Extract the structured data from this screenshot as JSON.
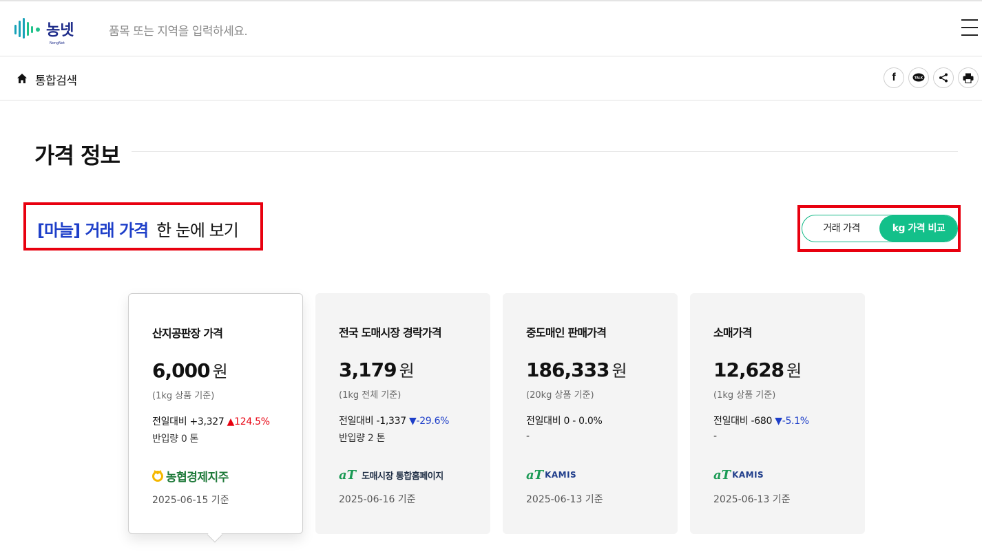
{
  "header": {
    "logo_text": "농넷",
    "logo_sub": "NongNet",
    "search_placeholder": "품목 또는 지역을 입력하세요."
  },
  "breadcrumb": {
    "label": "통합검색"
  },
  "share": {
    "icons": [
      "facebook-icon",
      "kakaotalk-icon",
      "share-icon",
      "print-icon"
    ],
    "facebook_glyph": "f",
    "kakao_glyph": "TALK"
  },
  "section": {
    "title": "가격 정보"
  },
  "heading": {
    "highlight": "[마늘] 거래 가격",
    "rest": "한 눈에 보기"
  },
  "toggle": {
    "option_a": "거래 가격",
    "option_b": "kg 가격 비교",
    "selected": "kg 가격 비교",
    "accent_color": "#13c08a"
  },
  "colors": {
    "up": "#e8000f",
    "down": "#1e3fc9",
    "highlight": "#1e3fc9",
    "annotation_box": "#e8000f"
  },
  "cards": [
    {
      "title": "산지공판장 가격",
      "price": "6,000",
      "unit": "원",
      "basis": "(1kg 상품 기준)",
      "change_label": "전일대비",
      "change_value": "+3,327",
      "change_arrow": "▲",
      "change_pct": "124.5%",
      "direction": "up",
      "volume": "반입량 0 톤",
      "source": "농협경제지주",
      "date": "2025-06-15 기준",
      "active": true
    },
    {
      "title": "전국 도매시장 경락가격",
      "price": "3,179",
      "unit": "원",
      "basis": "(1kg 전체 기준)",
      "change_label": "전일대비",
      "change_value": "-1,337",
      "change_arrow": "▼",
      "change_pct": "-29.6%",
      "direction": "down",
      "volume": "반입량 2 톤",
      "source_mark": "aT",
      "source": "도매시장 통합홈페이지",
      "date": "2025-06-16 기준",
      "active": false
    },
    {
      "title": "중도매인 판매가격",
      "price": "186,333",
      "unit": "원",
      "basis": "(20kg 상품 기준)",
      "change_label": "전일대비",
      "change_value": "0",
      "change_arrow": "-",
      "change_pct": "0.0%",
      "direction": "flat",
      "volume": "-",
      "source_mark": "aT",
      "source": "KAMIS",
      "date": "2025-06-13 기준",
      "active": false
    },
    {
      "title": "소매가격",
      "price": "12,628",
      "unit": "원",
      "basis": "(1kg 상품 기준)",
      "change_label": "전일대비",
      "change_value": "-680",
      "change_arrow": "▼",
      "change_pct": "-5.1%",
      "direction": "down",
      "volume": "-",
      "source_mark": "aT",
      "source": "KAMIS",
      "date": "2025-06-13 기준",
      "active": false
    }
  ]
}
